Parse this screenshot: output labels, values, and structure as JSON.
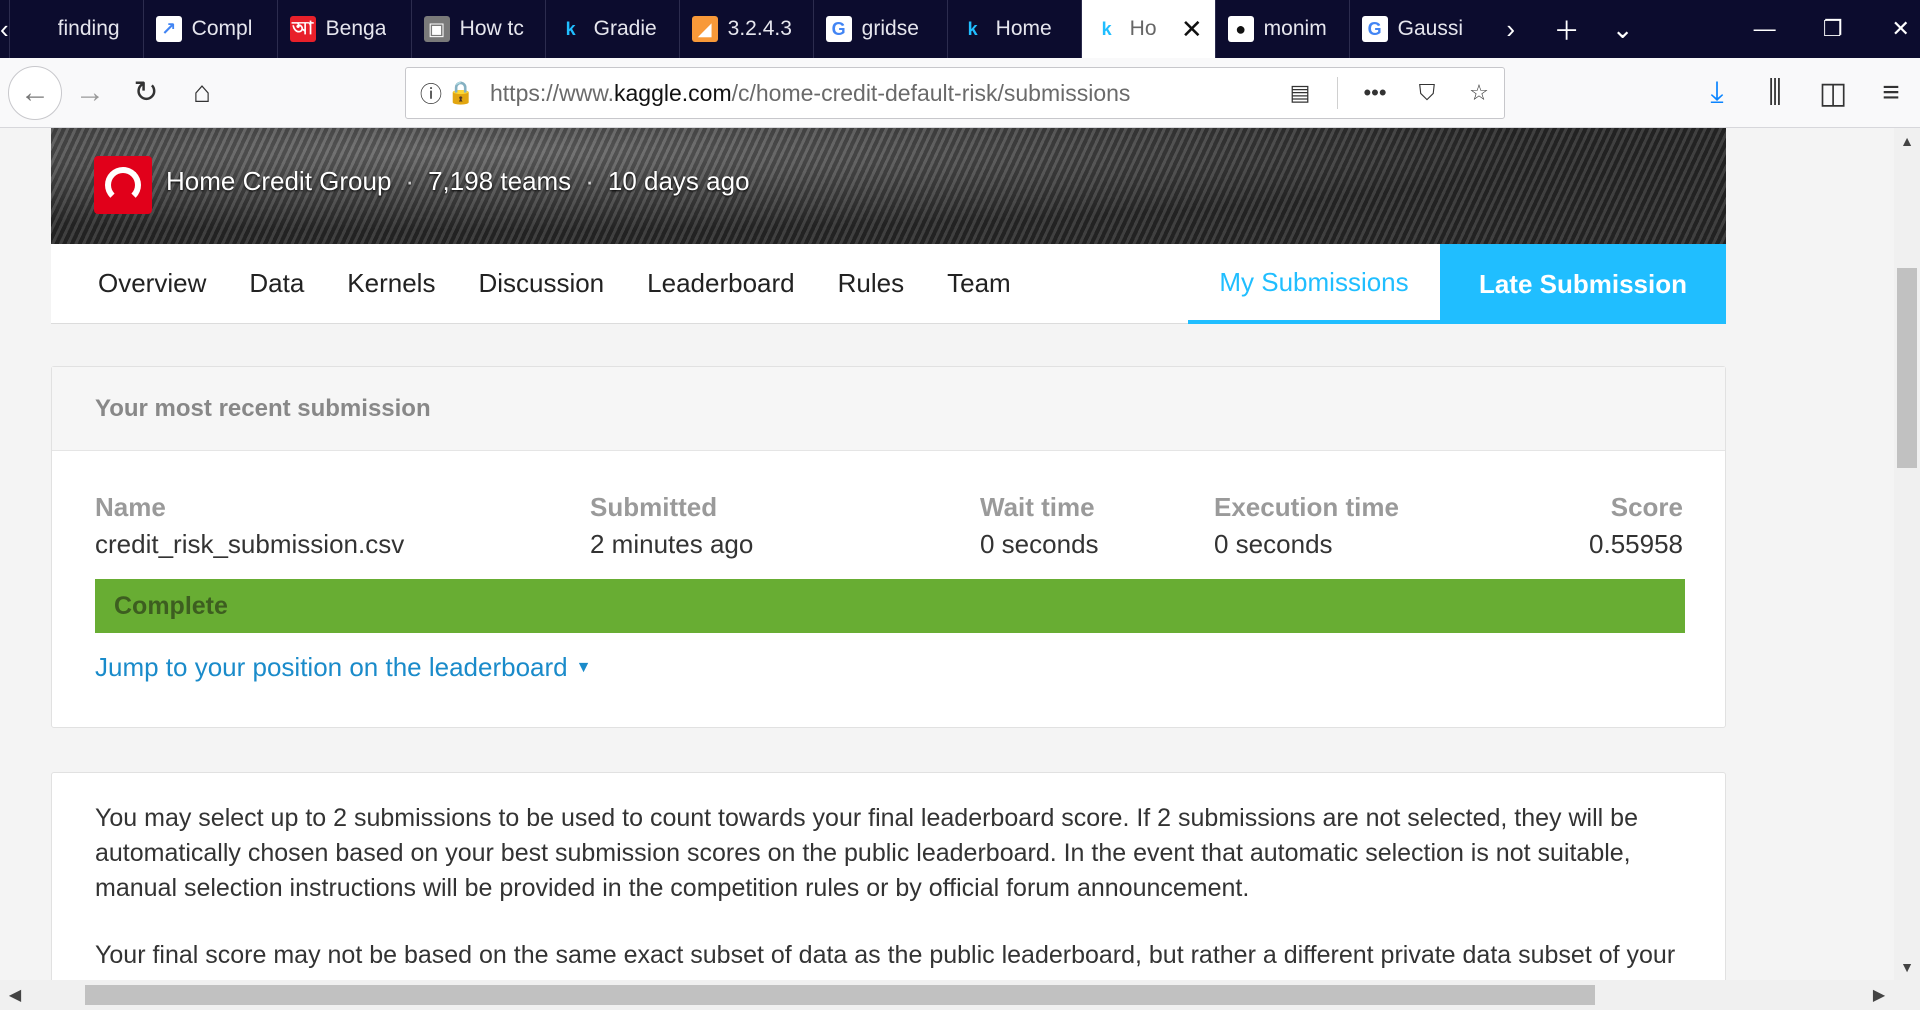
{
  "browser": {
    "tabs": [
      {
        "label": "finding",
        "icon": "document-icon",
        "fav_color": "#0c0c2e",
        "glyph": ""
      },
      {
        "label": "Compl",
        "icon": "chart-icon",
        "fav_color": "#ffffff",
        "glyph": "↗"
      },
      {
        "label": "Benga",
        "icon": "bengali-site-icon",
        "fav_color": "#e8202a",
        "glyph": "আ"
      },
      {
        "label": "How tc",
        "icon": "person-avatar-icon",
        "fav_color": "#7a7a7a",
        "glyph": "▣"
      },
      {
        "label": "Gradie",
        "icon": "kaggle-icon",
        "fav_color": "#0c0c2e",
        "glyph": "k"
      },
      {
        "label": "3.2.4.3",
        "icon": "sklearn-icon",
        "fav_color": "#f89939",
        "glyph": "◢"
      },
      {
        "label": "gridse",
        "icon": "google-icon",
        "fav_color": "#ffffff",
        "glyph": "G"
      },
      {
        "label": "Home",
        "icon": "kaggle-icon",
        "fav_color": "#0c0c2e",
        "glyph": "k"
      },
      {
        "label": "Ho",
        "icon": "kaggle-icon",
        "fav_color": "#ffffff",
        "glyph": "k",
        "active": true
      },
      {
        "label": "monim",
        "icon": "github-icon",
        "fav_color": "#ffffff",
        "glyph": "●"
      },
      {
        "label": "Gaussi",
        "icon": "google-icon",
        "fav_color": "#ffffff",
        "glyph": "G"
      }
    ],
    "url_prefix": "https://www.",
    "url_host": "kaggle.com",
    "url_path": "/c/home-credit-default-risk/submissions"
  },
  "competition": {
    "host": "Home Credit Group",
    "teams": "7,198 teams",
    "deadline": "10 days ago",
    "nav": [
      "Overview",
      "Data",
      "Kernels",
      "Discussion",
      "Leaderboard",
      "Rules",
      "Team"
    ],
    "my_submissions": "My Submissions",
    "late_submission": "Late Submission"
  },
  "recent": {
    "heading": "Your most recent submission",
    "columns": {
      "name": {
        "label": "Name",
        "value": "credit_risk_submission.csv"
      },
      "submitted": {
        "label": "Submitted",
        "value": "2 minutes ago"
      },
      "wait": {
        "label": "Wait time",
        "value": "0 seconds"
      },
      "exec": {
        "label": "Execution time",
        "value": "0 seconds"
      },
      "score": {
        "label": "Score",
        "value": "0.55958"
      }
    },
    "status": "Complete",
    "status_color": "#68ad33",
    "jump_link": "Jump to your position on the leaderboard"
  },
  "info": {
    "para1": "You may select up to 2 submissions to be used to count towards your final leaderboard score. If 2 submissions are not selected, they will be automatically chosen based on your best submission scores on the public leaderboard. In the event that automatic selection is not suitable, manual selection instructions will be provided in the competition rules or by official forum announcement.",
    "para2": "Your final score may not be based on the same exact subset of data as the public leaderboard, but rather a different private data subset of your full submission — your public score is only a rough indication of what your final score is."
  },
  "colors": {
    "accent": "#20beff",
    "link": "#1a8bca",
    "tabbar": "#0c0c2e",
    "logo": "#e1001a"
  }
}
